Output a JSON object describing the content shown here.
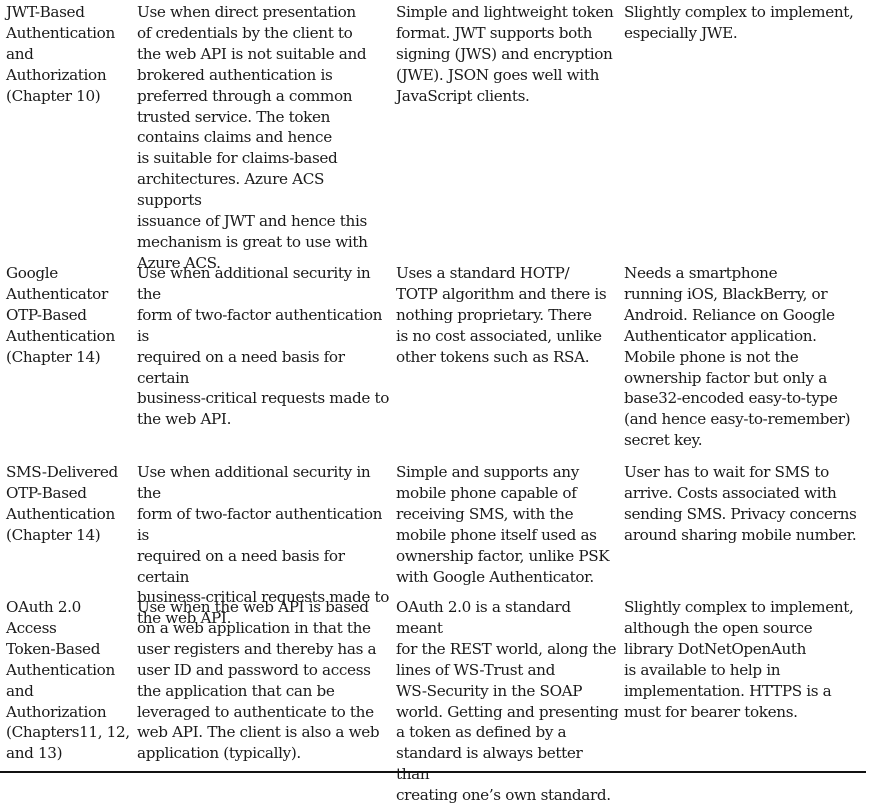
{
  "table": {
    "rows": [
      {
        "mechanism": "JWT-Based\nAuthentication\nand\nAuthorization\n(Chapter 10)",
        "when_to_use": "Use when direct presentation\nof credentials by the client to\nthe web API is not suitable and\nbrokered authentication is\npreferred through a common\ntrusted service. The token\ncontains claims and hence\nis suitable for claims-based\narchitectures. Azure ACS supports\nissuance of JWT and hence this\nmechanism is great to use with\nAzure ACS.",
        "strengths": "Simple and lightweight token\nformat. JWT supports both\nsigning (JWS) and encryption\n(JWE). JSON goes well with\nJavaScript clients.",
        "weaknesses": "Slightly complex to implement,\nespecially JWE."
      },
      {
        "mechanism": "Google\nAuthenticator\nOTP-Based\nAuthentication\n(Chapter 14)",
        "when_to_use": "Use when additional security in the\nform of two-factor authentication is\nrequired on a need basis for certain\nbusiness-critical requests made to\nthe web API.",
        "strengths": "Uses a standard HOTP/\nTOTP algorithm and there is\nnothing proprietary. There\nis no cost associated, unlike\nother tokens such as RSA.",
        "weaknesses": "Needs a smartphone\nrunning iOS, BlackBerry, or\nAndroid. Reliance on Google\nAuthenticator application.\nMobile phone is not the\nownership factor but only a\nbase32-encoded easy-to-type\n(and hence easy-to-remember)\nsecret key."
      },
      {
        "mechanism": "SMS-Delivered\nOTP-Based\nAuthentication\n(Chapter 14)",
        "when_to_use": "Use when additional security in the\nform of two-factor authentication is\nrequired on a need basis for certain\nbusiness-critical requests made to\nthe web API.",
        "strengths": "Simple and supports any\nmobile phone capable of\nreceiving SMS, with the\nmobile phone itself used as\nownership factor, unlike PSK\nwith Google Authenticator.",
        "weaknesses": "User has to wait for SMS to\narrive. Costs associated with\nsending SMS. Privacy concerns\naround sharing mobile number."
      },
      {
        "mechanism": "OAuth 2.0\nAccess\nToken-Based\nAuthentication\nand\nAuthorization\n(Chapters11, 12,\nand 13)",
        "when_to_use": "Use when the web API is based\non a web application in that the\nuser registers and thereby has a\nuser ID and password to access\nthe application that can be\nleveraged to authenticate to the\nweb API. The client is also a web\napplication (typically).",
        "strengths": "OAuth 2.0 is a standard meant\nfor the REST world, along the\nlines of WS-Trust and\nWS-Security in the SOAP\nworld. Getting and presenting\na token as defined by a\nstandard is always better than\ncreating one’s own standard.",
        "weaknesses": "Slightly complex to implement,\nalthough the open source\nlibrary DotNetOpenAuth\nis available to help in\nimplementation. HTTPS is a\nmust for bearer tokens."
      }
    ]
  }
}
